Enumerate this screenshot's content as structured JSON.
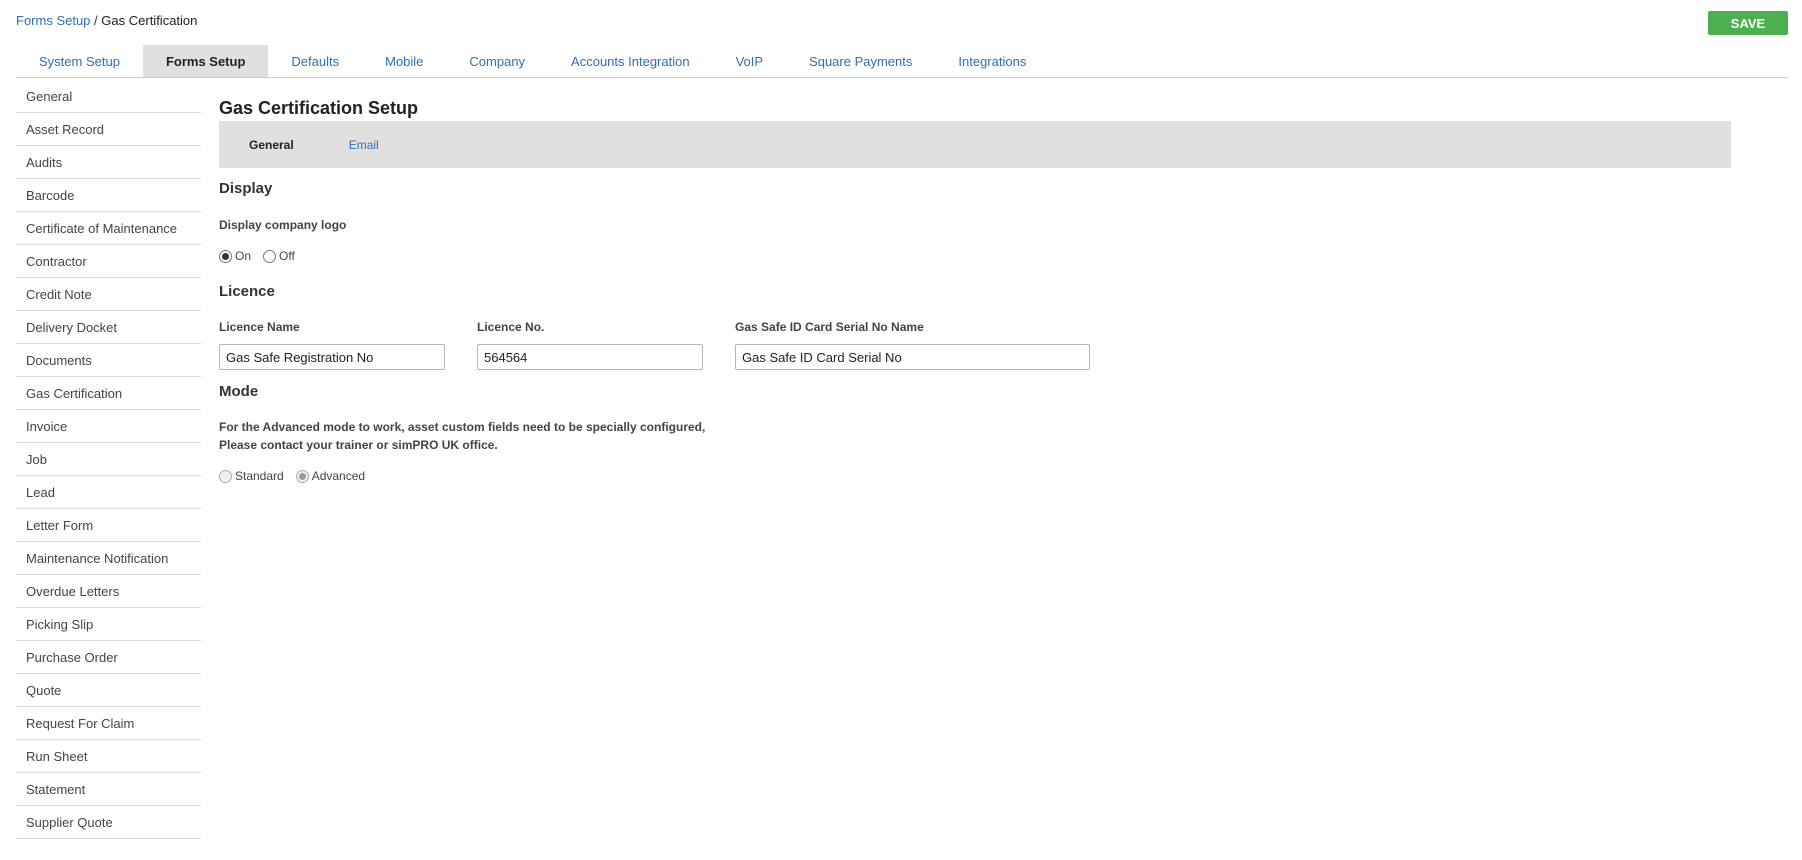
{
  "breadcrumb": {
    "parent": "Forms Setup",
    "separator": "/",
    "current": "Gas Certification"
  },
  "save_label": "SAVE",
  "top_tabs": [
    {
      "label": "System Setup",
      "active": false
    },
    {
      "label": "Forms Setup",
      "active": true
    },
    {
      "label": "Defaults",
      "active": false
    },
    {
      "label": "Mobile",
      "active": false
    },
    {
      "label": "Company",
      "active": false
    },
    {
      "label": "Accounts Integration",
      "active": false
    },
    {
      "label": "VoIP",
      "active": false
    },
    {
      "label": "Square Payments",
      "active": false
    },
    {
      "label": "Integrations",
      "active": false
    }
  ],
  "sidebar": {
    "items": [
      {
        "label": "General"
      },
      {
        "label": "Asset Record"
      },
      {
        "label": "Audits"
      },
      {
        "label": "Barcode"
      },
      {
        "label": "Certificate of Maintenance"
      },
      {
        "label": "Contractor"
      },
      {
        "label": "Credit Note"
      },
      {
        "label": "Delivery Docket"
      },
      {
        "label": "Documents"
      },
      {
        "label": "Gas Certification"
      },
      {
        "label": "Invoice"
      },
      {
        "label": "Job"
      },
      {
        "label": "Lead"
      },
      {
        "label": "Letter Form"
      },
      {
        "label": "Maintenance Notification"
      },
      {
        "label": "Overdue Letters"
      },
      {
        "label": "Picking Slip"
      },
      {
        "label": "Purchase Order"
      },
      {
        "label": "Quote"
      },
      {
        "label": "Request For Claim"
      },
      {
        "label": "Run Sheet"
      },
      {
        "label": "Statement"
      },
      {
        "label": "Supplier Quote"
      }
    ]
  },
  "main": {
    "title": "Gas Certification Setup",
    "sub_tabs": [
      {
        "label": "General",
        "active": true
      },
      {
        "label": "Email",
        "active": false
      }
    ],
    "display": {
      "title": "Display",
      "logo_label": "Display company logo",
      "on_label": "On",
      "off_label": "Off",
      "selected": "On"
    },
    "licence": {
      "title": "Licence",
      "name_label": "Licence Name",
      "name_value": "Gas Safe Registration No",
      "number_label": "Licence No.",
      "number_value": "564564",
      "card_label": "Gas Safe ID Card Serial No Name",
      "card_value": "Gas Safe ID Card Serial No"
    },
    "mode": {
      "title": "Mode",
      "note_line1": "For the Advanced mode to work, asset custom fields need to be specially configured,",
      "note_line2": "Please contact your trainer or simPRO UK office.",
      "standard_label": "Standard",
      "advanced_label": "Advanced",
      "selected": "Advanced"
    }
  }
}
